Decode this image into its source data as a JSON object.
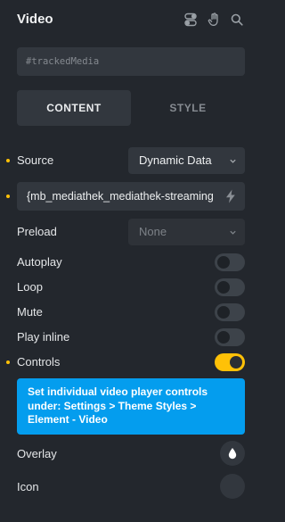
{
  "header": {
    "title": "Video",
    "icons": [
      "toggle-switch-icon",
      "hand-pointer-icon",
      "search-icon"
    ]
  },
  "css_id": {
    "value": "#trackedMedia"
  },
  "tabs": [
    {
      "label": "CONTENT",
      "active": true
    },
    {
      "label": "STYLE",
      "active": false
    }
  ],
  "fields": {
    "source": {
      "label": "Source",
      "value": "Dynamic Data"
    },
    "dynamic_data": {
      "value": "{mb_mediathek_mediathek-streaming"
    },
    "preload": {
      "label": "Preload",
      "placeholder": "None"
    },
    "autoplay": {
      "label": "Autoplay",
      "on": false
    },
    "loop": {
      "label": "Loop",
      "on": false
    },
    "mute": {
      "label": "Mute",
      "on": false
    },
    "play_inline": {
      "label": "Play inline",
      "on": false
    },
    "controls": {
      "label": "Controls",
      "on": true
    },
    "controls_info": "Set individual video player controls under: Settings > Theme Styles > Element - Video",
    "overlay": {
      "label": "Overlay",
      "icon": "water-drop-icon"
    },
    "icon": {
      "label": "Icon"
    }
  },
  "colors": {
    "accent": "#ffc107",
    "info": "#049dee",
    "background": "#23272d",
    "field": "#32373e"
  }
}
